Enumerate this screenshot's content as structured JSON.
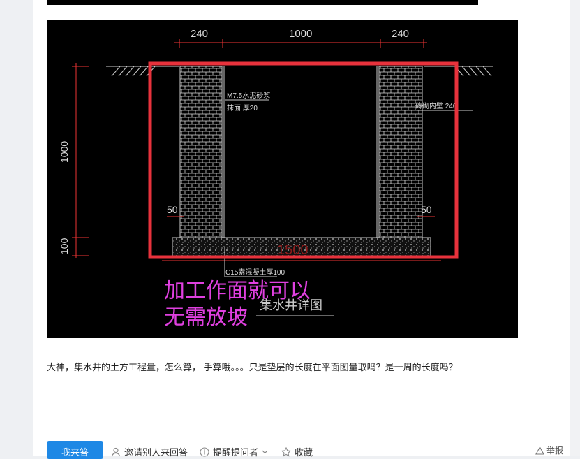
{
  "drawing": {
    "dim_top_left": "240",
    "dim_top_mid": "1000",
    "dim_top_right": "240",
    "dim_left_height": "1000",
    "dim_left_base": "100",
    "note_mortar_1": "M7.5水泥砂浆",
    "note_mortar_2": "抹面 厚20",
    "note_wall": "砖砌内壁 240",
    "dim_50_left": "50",
    "dim_50_right": "50",
    "base_label": "1500",
    "note_concrete": "C15素混凝土厚100",
    "drawing_title": "集水井详图",
    "annotation_line1": "加工作面就可以",
    "annotation_line2": "无需放坡",
    "colors": {
      "highlight_box": "#e8323c",
      "annotation": "#e040e0"
    }
  },
  "question": {
    "text": "大神，集水井的土方工程量，怎么算， 手算哦。。。只是垫层的长度在平面图量取吗？是一周的长度吗？"
  },
  "toolbar": {
    "answer_label": "我来答",
    "invite_label": "邀请别人来回答",
    "remind_label": "提醒提问者",
    "favorite_label": "收藏",
    "report_label": "举报",
    "accent": "#1e88e5"
  }
}
